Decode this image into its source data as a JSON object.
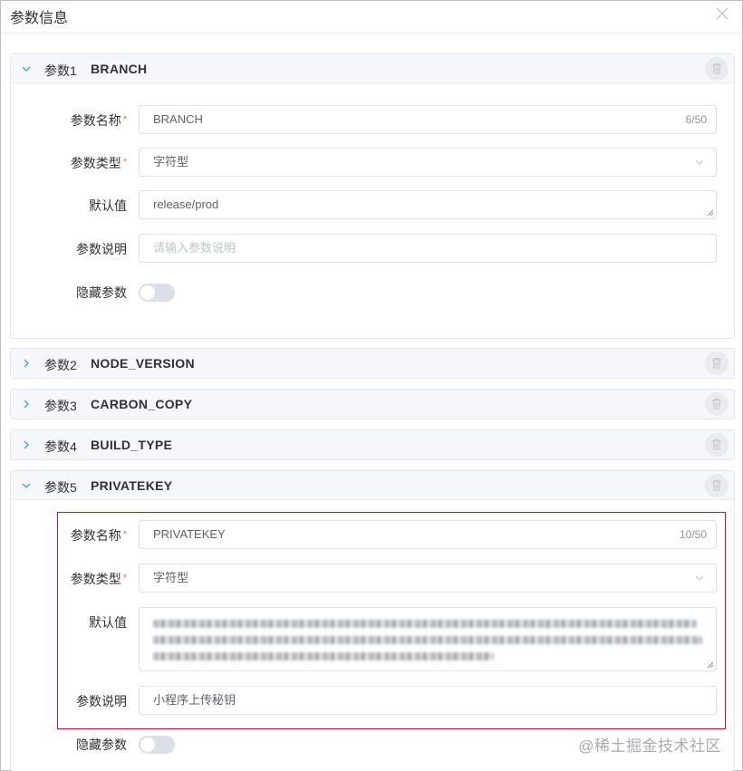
{
  "dialog": {
    "title": "参数信息"
  },
  "icons": {
    "close": "close-icon",
    "expand": "chevron-down-icon",
    "collapse": "chevron-right-icon",
    "delete": "trash-icon",
    "select": "chevron-down-icon"
  },
  "colors": {
    "accent": "#409eff",
    "required": "#f56c6c",
    "highlight_border": "#c8102e"
  },
  "labels": {
    "name": "参数名称",
    "type": "参数类型",
    "default": "默认值",
    "description": "参数说明",
    "hidden": "隐藏参数"
  },
  "params": [
    {
      "index": "参数1",
      "name": "BRANCH",
      "expanded": true,
      "name_value": "BRANCH",
      "name_count": "6/50",
      "type_value": "字符型",
      "default_value": "release/prod",
      "description_placeholder": "请输入参数说明",
      "hidden": false
    },
    {
      "index": "参数2",
      "name": "NODE_VERSION",
      "expanded": false
    },
    {
      "index": "参数3",
      "name": "CARBON_COPY",
      "expanded": false
    },
    {
      "index": "参数4",
      "name": "BUILD_TYPE",
      "expanded": false
    },
    {
      "index": "参数5",
      "name": "PRIVATEKEY",
      "expanded": true,
      "name_value": "PRIVATEKEY",
      "name_count": "10/50",
      "type_value": "字符型",
      "default_value_redacted": true,
      "description_value": "小程序上传秘钥",
      "hidden": false
    }
  ],
  "watermark": "@稀土掘金技术社区"
}
